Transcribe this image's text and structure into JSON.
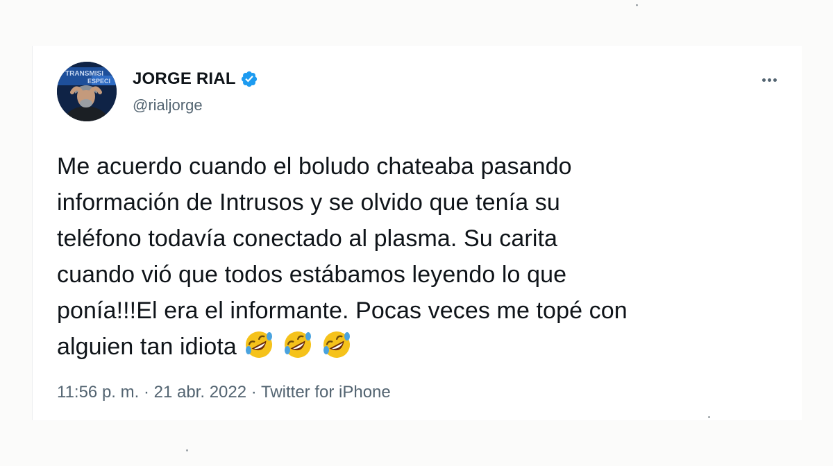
{
  "tweet": {
    "author": {
      "display_name": "JORGE RIAL",
      "handle": "@rialjorge",
      "verified": true,
      "avatar_banner_line1": "TRANSMISI",
      "avatar_banner_line2": "ESPECI"
    },
    "text_lines": [
      "Me acuerdo cuando el boludo chateaba pasando",
      "información de Intrusos y se olvido que tenía su",
      "teléfono todavía conectado al plasma. Su carita",
      "cuando vió que todos estábamos leyendo lo que",
      "ponía!!!El era el informante. Pocas veces me topé con",
      "alguien tan idiota"
    ],
    "emojis": [
      "rolling-on-floor-laughing",
      "rolling-on-floor-laughing",
      "rolling-on-floor-laughing"
    ],
    "time": "11:56 p. m.",
    "separator": " · ",
    "date": "21 abr. 2022",
    "source": "Twitter for iPhone"
  },
  "colors": {
    "text": "#0f1419",
    "secondary": "#536471",
    "verified": "#1d9bf0",
    "emoji_face": "#f5c21b"
  }
}
